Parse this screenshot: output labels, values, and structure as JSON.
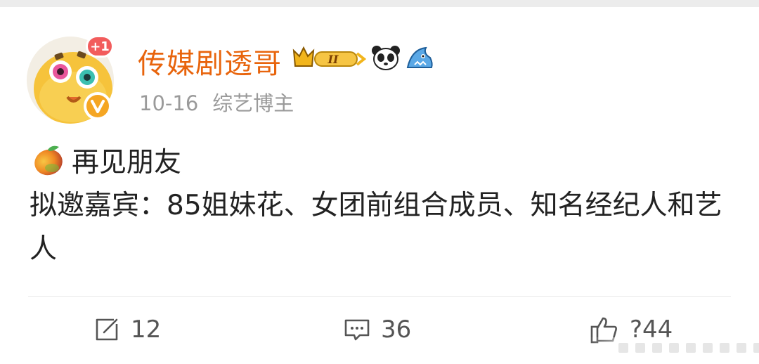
{
  "post": {
    "user": {
      "name": "传媒剧透哥",
      "badge_count": "+1",
      "vip_level": "II"
    },
    "meta": {
      "date": "10-16",
      "tag": "综艺博主"
    },
    "title_emoji": "mango",
    "title": "再见朋友",
    "body": "拟邀嘉宾：85姐妹花、女团前组合成员、知名经纪人和艺人"
  },
  "actions": {
    "share_count": "12",
    "comment_count": "36",
    "like_count": "?44"
  },
  "colors": {
    "username": "#e8640c",
    "badge": "#f25c5c",
    "meta": "#9a9a9a",
    "text": "#222222"
  }
}
